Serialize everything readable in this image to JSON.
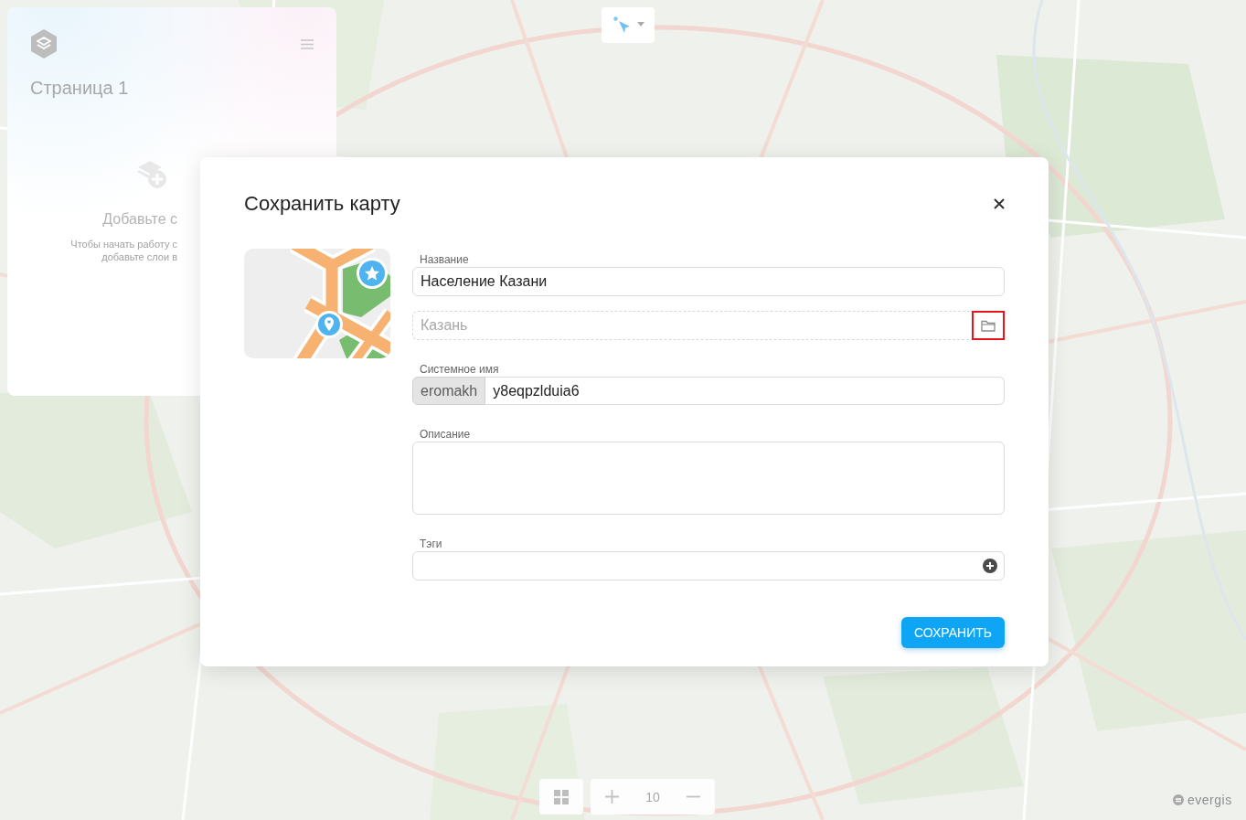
{
  "map": {
    "logo": "evergis"
  },
  "panel": {
    "title": "Страница 1",
    "empty_title": "Добавьте с",
    "empty_hint": "Чтобы начать работу с\nдобавьте слои в"
  },
  "zoom": {
    "value": "10"
  },
  "dialog": {
    "title": "Сохранить карту",
    "fields": [
      {
        "kind": "text",
        "label": "Название",
        "value": "Население Казани"
      },
      {
        "kind": "folder",
        "placeholder": "Казань",
        "highlighted": true
      },
      {
        "kind": "prefixed",
        "label": "Системное имя",
        "prefix": "eromakh",
        "value": "y8eqpzlduia6"
      },
      {
        "kind": "textarea",
        "label": "Описание"
      },
      {
        "kind": "tags",
        "label": "Тэги"
      }
    ],
    "save_button": "СОХРАНИТЬ"
  }
}
